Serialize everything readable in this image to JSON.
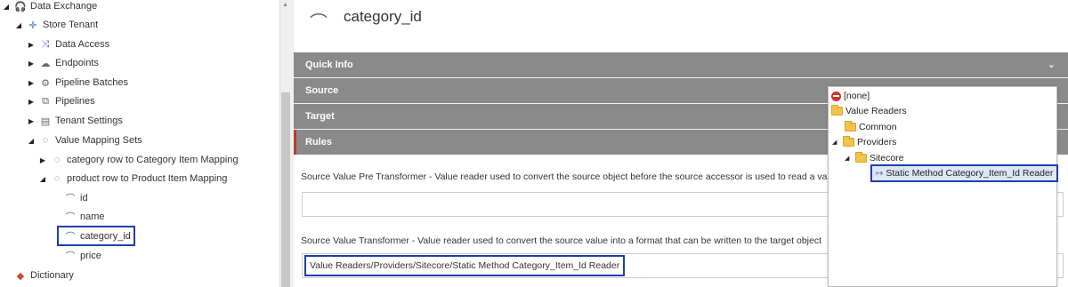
{
  "tree": {
    "nodes": [
      {
        "label": "Data Exchange",
        "icon": "data-exchange-icon",
        "expanded": true
      },
      {
        "label": "Store Tenant",
        "icon": "tenant-icon",
        "expanded": true
      },
      {
        "label": "Data Access",
        "icon": "shuffle-icon",
        "expanded": false
      },
      {
        "label": "Endpoints",
        "icon": "cloud-icon",
        "expanded": false
      },
      {
        "label": "Pipeline Batches",
        "icon": "batch-icon",
        "expanded": false
      },
      {
        "label": "Pipelines",
        "icon": "pipelines-icon",
        "expanded": false
      },
      {
        "label": "Tenant Settings",
        "icon": "settings-document-icon",
        "expanded": false
      },
      {
        "label": "Value Mapping Sets",
        "icon": "mapping-set-icon",
        "expanded": true
      },
      {
        "label": "category row to Category Item Mapping",
        "icon": "mapping-icon",
        "expanded": false
      },
      {
        "label": "product row to Product Item Mapping",
        "icon": "mapping-icon",
        "expanded": true
      },
      {
        "label": "id",
        "icon": "field-mapping-icon"
      },
      {
        "label": "name",
        "icon": "field-mapping-icon"
      },
      {
        "label": "category_id",
        "icon": "field-mapping-icon",
        "selected": true
      },
      {
        "label": "price",
        "icon": "field-mapping-icon"
      },
      {
        "label": "Dictionary",
        "icon": "dictionary-icon"
      }
    ]
  },
  "editor": {
    "item_title": "category_id",
    "item_icon": "field-mapping-icon",
    "sections": [
      {
        "label": "Quick Info"
      },
      {
        "label": "Source"
      },
      {
        "label": "Target"
      },
      {
        "label": "Rules"
      }
    ],
    "fields": {
      "pre_transformer_label": "Source Value Pre Transformer - Value reader used to convert the source object before the source accessor is used to read a va",
      "transformer_label": "Source Value Transformer - Value reader used to convert the source value into a format that can be written to the target object",
      "transformer_value": "Value Readers/Providers/Sitecore/Static Method Category_Item_Id Reader"
    }
  },
  "popup": {
    "items": [
      {
        "label": "[none]",
        "icon": "none-icon"
      },
      {
        "label": "Value Readers",
        "icon": "folder-icon"
      },
      {
        "label": "Common",
        "icon": "folder-icon"
      },
      {
        "label": "Providers",
        "icon": "folder-icon"
      },
      {
        "label": "Sitecore",
        "icon": "folder-icon"
      },
      {
        "label": "Static Method Category_Item_Id Reader",
        "icon": "static-method-icon",
        "selected": true
      }
    ]
  },
  "colors": {
    "section_bg": "#8a8a8a",
    "active_marker": "#c5362a",
    "highlight_border": "#1f3ea8",
    "folder": "#f3c24a"
  }
}
